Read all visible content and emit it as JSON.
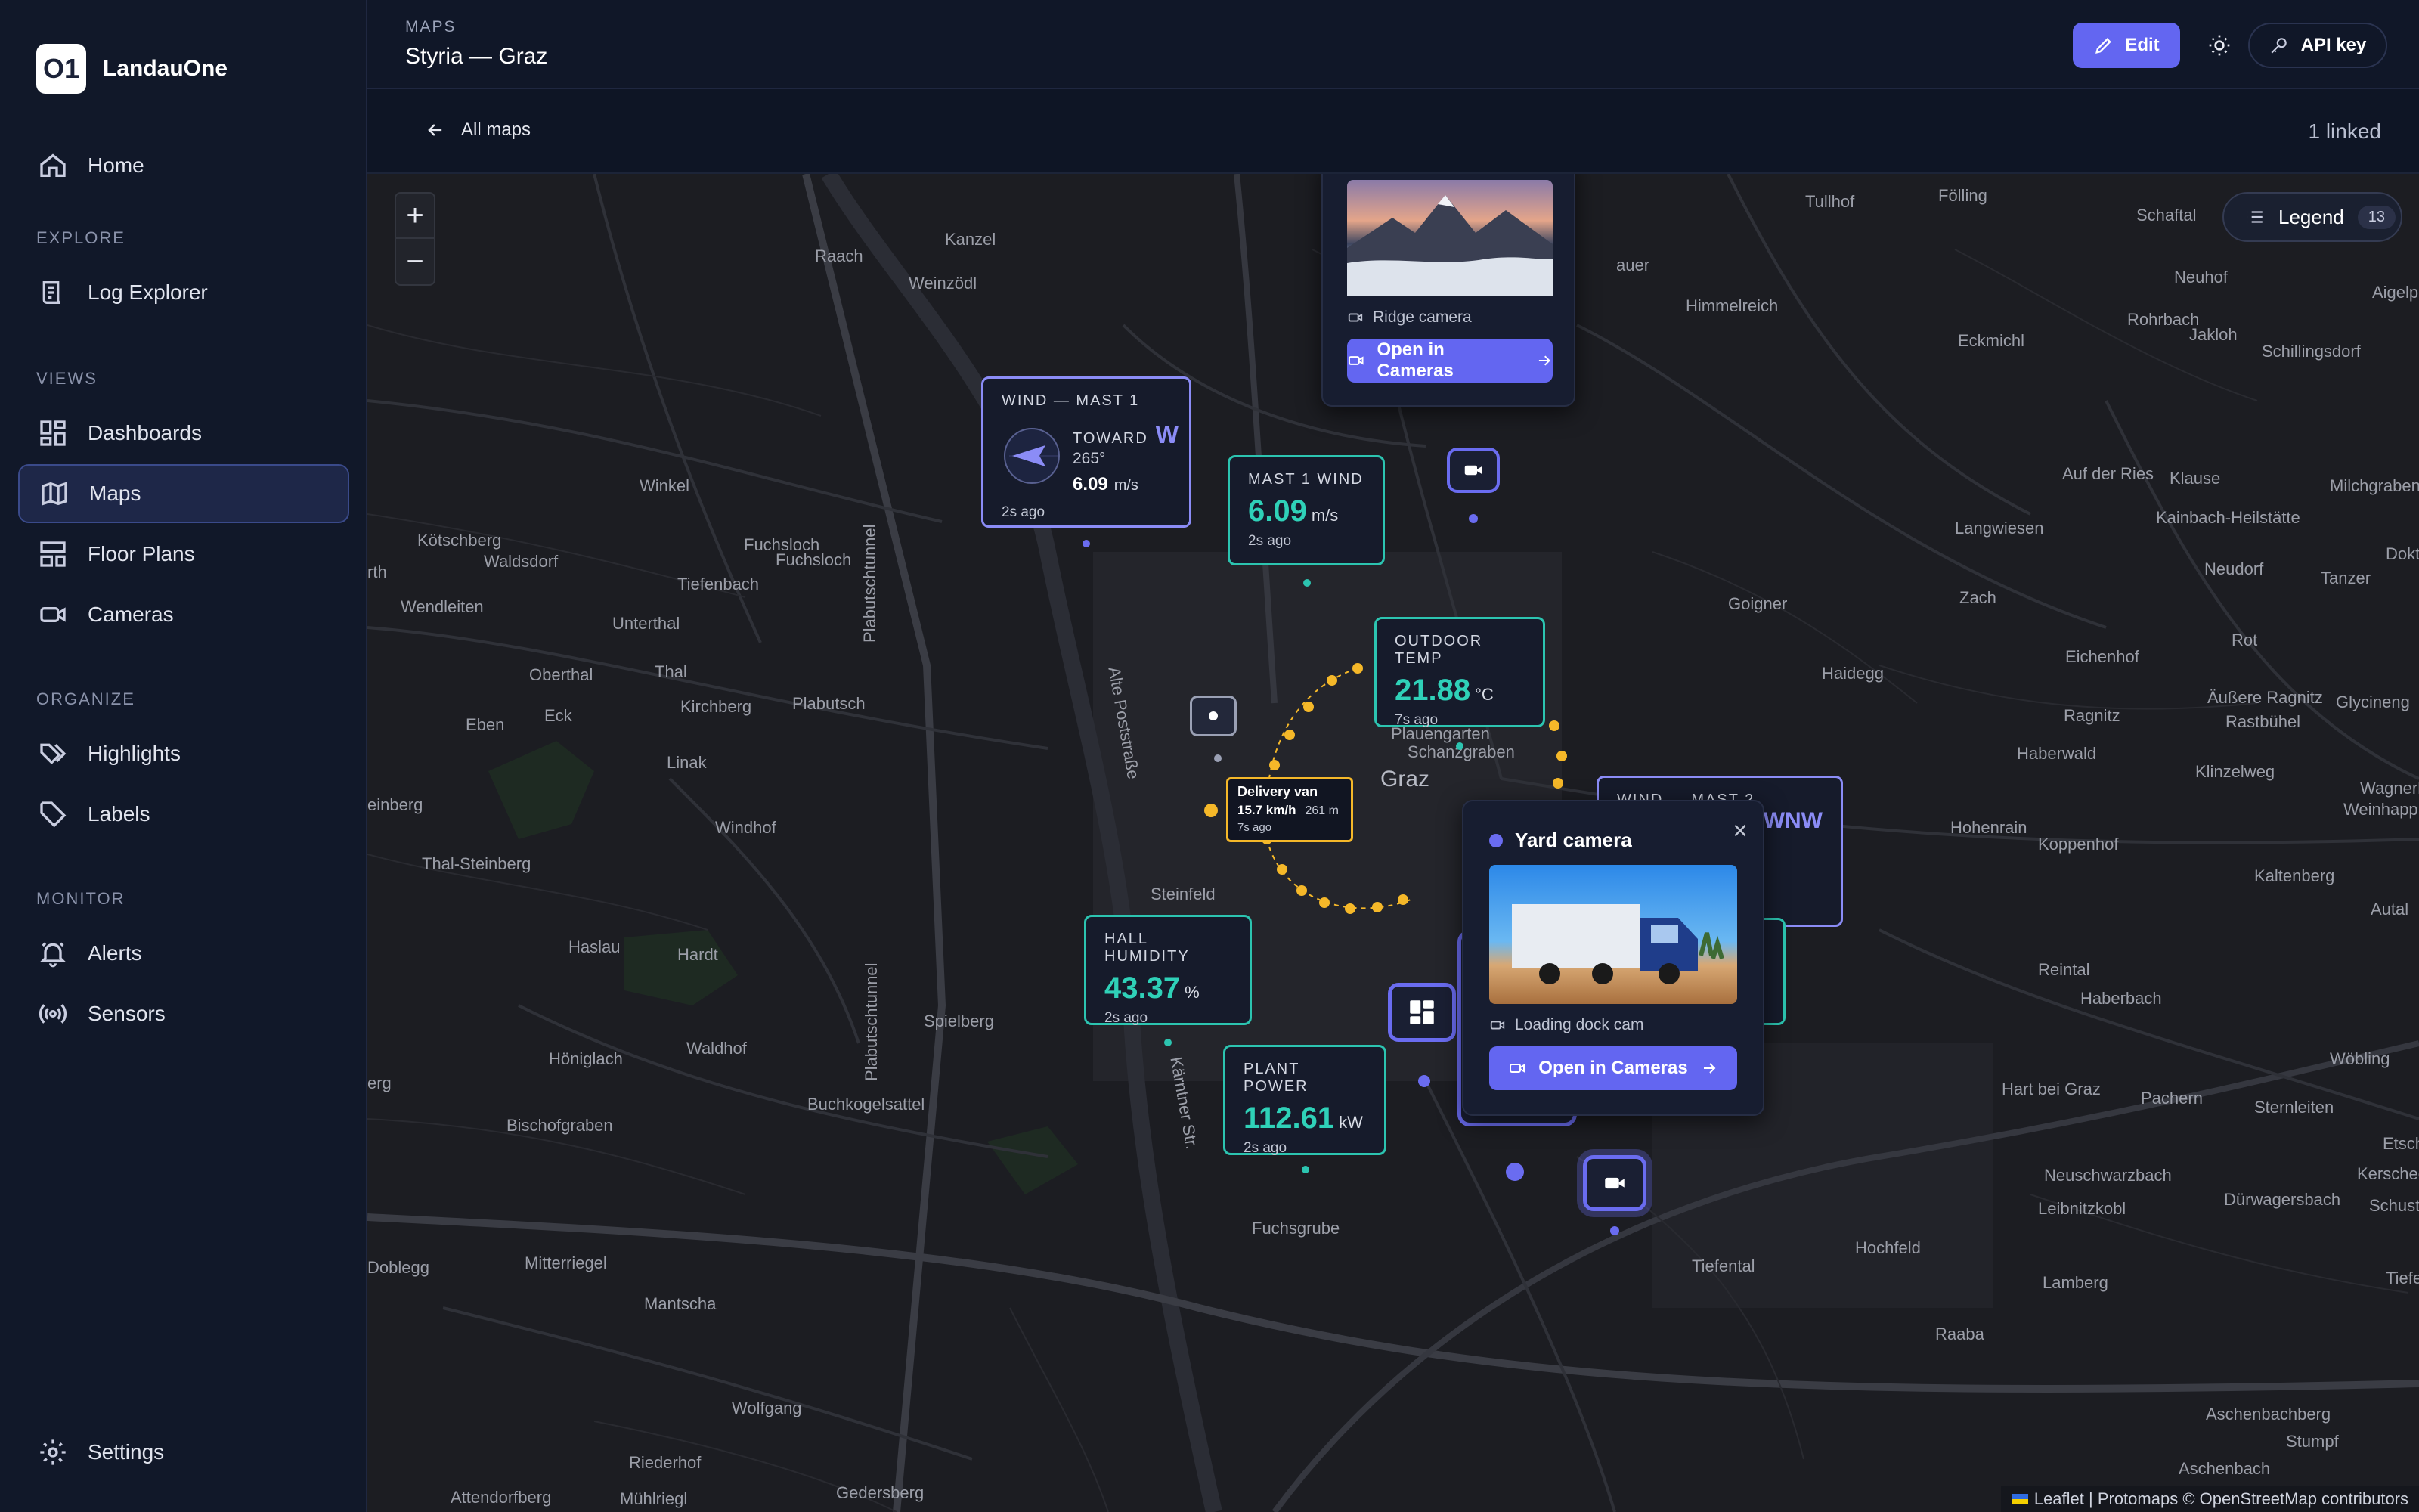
{
  "brand": {
    "logo_text": "O1",
    "name": "LandauOne"
  },
  "sidebar": {
    "home": "Home",
    "sections": {
      "explore": "EXPLORE",
      "views": "VIEWS",
      "organize": "ORGANIZE",
      "monitor": "MONITOR"
    },
    "items": {
      "log_explorer": "Log Explorer",
      "dashboards": "Dashboards",
      "maps": "Maps",
      "floor_plans": "Floor Plans",
      "cameras": "Cameras",
      "highlights": "Highlights",
      "labels": "Labels",
      "alerts": "Alerts",
      "sensors": "Sensors"
    },
    "settings": "Settings"
  },
  "header": {
    "section": "MAPS",
    "title": "Styria — Graz",
    "edit": "Edit",
    "api_key": "API key"
  },
  "subbar": {
    "back": "All maps",
    "linked": "1 linked"
  },
  "map": {
    "legend": "Legend",
    "legend_count": "13",
    "zoom_in": "+",
    "zoom_out": "−",
    "attribution": "Leaflet | Protomaps © OpenStreetMap contributors",
    "places": {
      "tullhof": "Tullhof",
      "folling": "Fölling",
      "schaftal": "Schaftal",
      "aigelp": "Aigelp",
      "kanzel": "Kanzel",
      "raach": "Raach",
      "weinzodl": "Weinzödl",
      "auer": "auer",
      "himmelreich": "Himmelreich",
      "eckmichl": "Eckmichl",
      "neuhof": "Neuhof",
      "rohrbach": "Rohrbach",
      "jakloh": "Jakloh",
      "schillingsdorf": "Schillingsdorf",
      "winkel": "Winkel",
      "plabutschtunnel": "Plabutschtunnel",
      "kotschberg": "Kötschberg",
      "fuchsloch1": "Fuchsloch",
      "fuchsloch2": "Fuchsloch",
      "waldsdorf": "Waldsdorf",
      "tiefenbach": "Tiefenbach",
      "rth": "rth",
      "wendleiten": "Wendleiten",
      "unterthal": "Unterthal",
      "oberthal": "Oberthal",
      "thal": "Thal",
      "kirchberg": "Kirchberg",
      "plabutsch": "Plabutsch",
      "eben": "Eben",
      "eck": "Eck",
      "linak": "Linak",
      "windhof": "Windhof",
      "einberg": "einberg",
      "thalsteinberg": "Thal-Steinberg",
      "alte_poststrasse": "Alte Poststraße",
      "plauengarten": "Plauengarten",
      "schanzgraben": "Schanzgraben",
      "graz": "Graz",
      "auf_der_ries": "Auf der Ries",
      "klause": "Klause",
      "kainbach": "Kainbach-Heilstätte",
      "milchgraben": "Milchgraben",
      "langwiesen": "Langwiesen",
      "goigner": "Goigner",
      "zach": "Zach",
      "neudorf": "Neudorf",
      "tanzer": "Tanzer",
      "doktor": "Doktor",
      "haidegg": "Haidegg",
      "eichenhof": "Eichenhof",
      "rot": "Rot",
      "aussere_ragnitz": "Äußere Ragnitz",
      "glycineng": "Glycineng",
      "ragnitz": "Ragnitz",
      "rastbuhel": "Rastbühel",
      "haberwald": "Haberwald",
      "klinzelweg": "Klinzelweg",
      "wagnerhie": "Wagnerhie",
      "weinhappl": "Weinhappl",
      "hohenrain": "Hohenrain",
      "koppenhof": "Koppenhof",
      "kaltenberg": "Kaltenberg",
      "autal": "Autal",
      "steinfeld": "Steinfeld",
      "haslau": "Haslau",
      "hardt": "Hardt",
      "spielberg": "Spielberg",
      "plabutschtunnel2": "Plabutschtunnel",
      "honigloch": "Höniglach",
      "waldhof": "Waldhof",
      "erg": "erg",
      "buchkogelsattel": "Buchkogelsattel",
      "karntner": "Kärntner Str.",
      "bischofgraben": "Bischofgraben",
      "reintal": "Reintal",
      "haberbach": "Haberbach",
      "wobling": "Wöbling",
      "hart_bei_graz": "Hart bei Graz",
      "pachern": "Pachern",
      "sternleiten": "Sternleiten",
      "etsche": "Etsche",
      "kerscheck": "Kerscheck",
      "schuster": "Schuster",
      "leibnitzkobl": "Leibnitzkobl",
      "neuschwarzbach": "Neuschwarzbach",
      "durwagersbach": "Dürwagersbach",
      "fuchsgrube": "Fuchsgrube",
      "doblegg": "Doblegg",
      "mitterriegel": "Mitterriegel",
      "hochfeld": "Hochfeld",
      "tiefental": "Tiefental",
      "lamberg": "Lamberg",
      "tiefen": "Tiefen",
      "mantscha": "Mantscha",
      "raaba": "Raaba",
      "wolfgang": "Wolfgang",
      "aschenbachberg": "Aschenbachberg",
      "stumpf": "Stumpf",
      "riederhof": "Riederhof",
      "aschenbach": "Aschenbach",
      "attendorfberg": "Attendorfberg",
      "muhlriegl": "Mühlriegl",
      "gedersberg": "Gedersberg"
    }
  },
  "widgets": {
    "ridge_popup": {
      "caption": "Ridge camera",
      "button": "Open in Cameras"
    },
    "wind1": {
      "title": "WIND — MAST 1",
      "toward": "TOWARD",
      "dir": "W",
      "deg": "265°",
      "speed": "6.09",
      "unit": "m/s",
      "ago": "2s ago"
    },
    "mast1_wind": {
      "title": "MAST 1 WIND",
      "value": "6.09",
      "unit": "m/s",
      "ago": "2s ago"
    },
    "outdoor_temp": {
      "title": "OUTDOOR TEMP",
      "value": "21.88",
      "unit": "°C",
      "ago": "7s ago"
    },
    "delivery_van": {
      "title": "Delivery van",
      "speed": "15.7 km/h",
      "dist": "261 m",
      "ago": "7s ago"
    },
    "wind2": {
      "title": "WIND — MAST 2",
      "dir": "WNW"
    },
    "hall_humidity": {
      "title": "HALL HUMIDITY",
      "value": "43.37",
      "unit": "%",
      "ago": "2s ago"
    },
    "plant_power": {
      "title": "PLANT POWER",
      "value": "112.61",
      "unit": "kW",
      "ago": "2s ago"
    },
    "yard_popup": {
      "title": "Yard camera",
      "caption": "Loading dock cam",
      "button": "Open in Cameras",
      "close": "×"
    }
  },
  "colors": {
    "accent": "#6366f1",
    "teal": "#2fd1b8",
    "van": "#f5b829"
  }
}
